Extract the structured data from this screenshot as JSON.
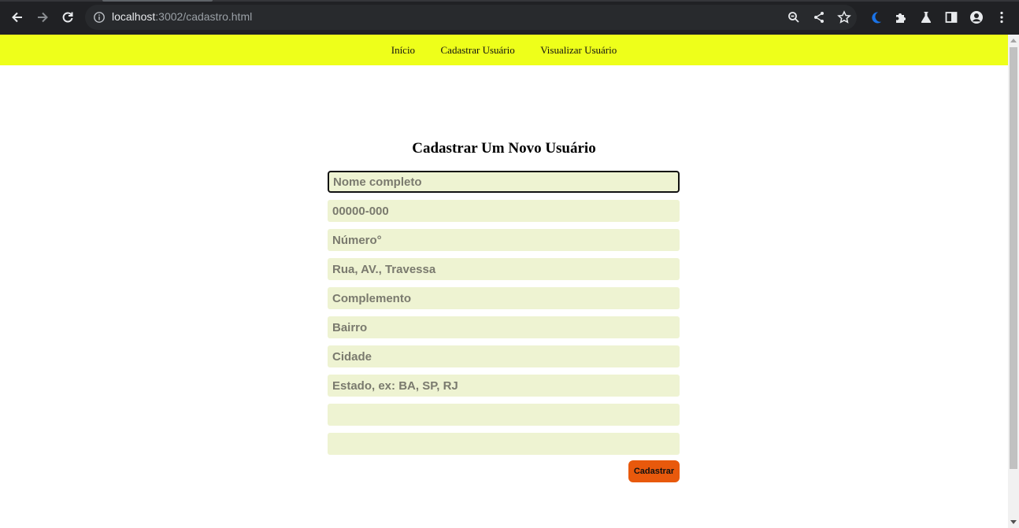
{
  "browser": {
    "url_host": "localhost",
    "url_rest": ":3002/cadastro.html",
    "icons": [
      "back-arrow-icon",
      "forward-arrow-icon",
      "reload-icon",
      "info-icon",
      "zoom-icon",
      "share-icon",
      "star-icon",
      "moon-icon",
      "puzzle-icon",
      "flask-icon",
      "side-panel-icon",
      "profile-icon",
      "menu-icon"
    ]
  },
  "nav": {
    "items": [
      {
        "label": "Início"
      },
      {
        "label": "Cadastrar Usuário"
      },
      {
        "label": "Visualizar Usuário"
      }
    ]
  },
  "form": {
    "title": "Cadastrar Um Novo Usuário",
    "fields": [
      {
        "placeholder": "Nome completo",
        "value": ""
      },
      {
        "placeholder": "00000-000",
        "value": ""
      },
      {
        "placeholder": "Número°",
        "value": ""
      },
      {
        "placeholder": "Rua, AV., Travessa",
        "value": ""
      },
      {
        "placeholder": "Complemento",
        "value": ""
      },
      {
        "placeholder": "Bairro",
        "value": ""
      },
      {
        "placeholder": "Cidade",
        "value": ""
      },
      {
        "placeholder": "Estado, ex: BA, SP, RJ",
        "value": ""
      },
      {
        "placeholder": "",
        "value": ""
      },
      {
        "placeholder": "",
        "value": ""
      }
    ],
    "submit_label": "Cadastrar"
  },
  "colors": {
    "nav_background": "#eeff1a",
    "field_background": "#eef3d2",
    "button_background": "#e8590c"
  }
}
